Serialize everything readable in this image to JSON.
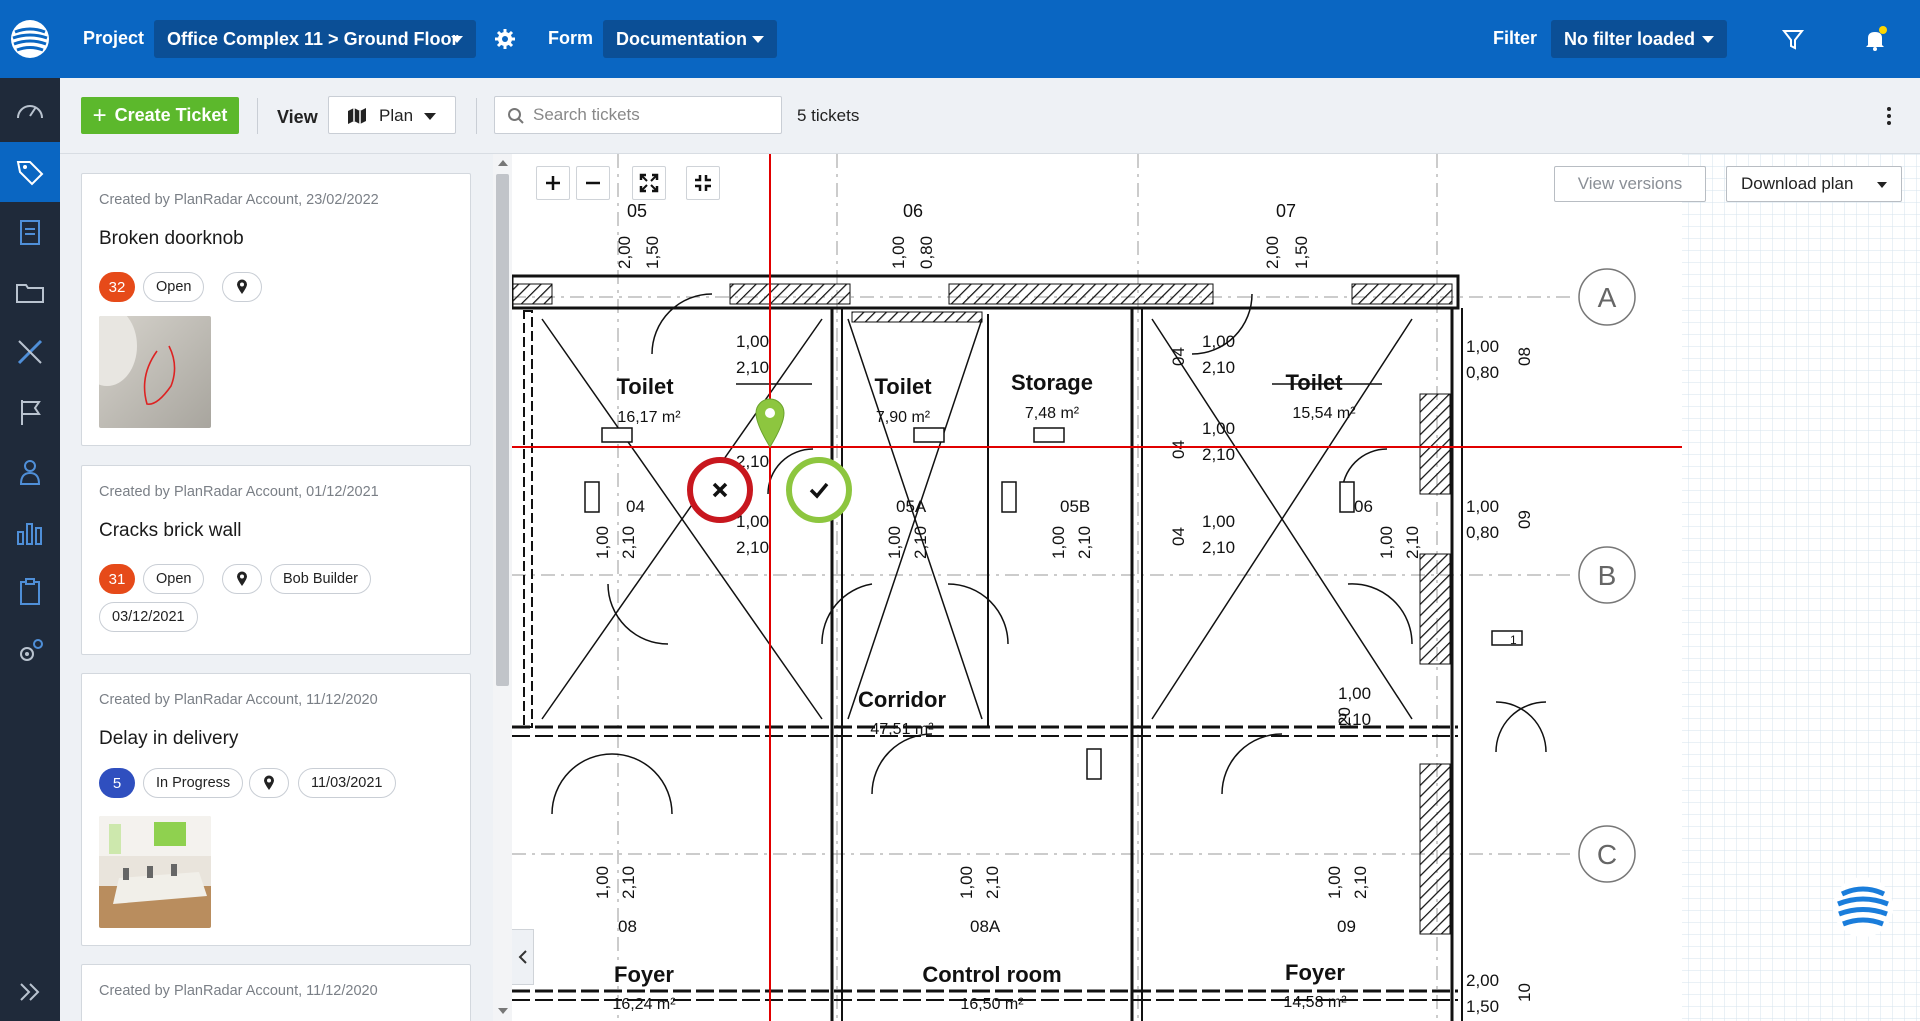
{
  "header": {
    "project_label": "Project",
    "project_value": "Office Complex 11 > Ground Floor",
    "form_label": "Form",
    "form_value": "Documentation",
    "filter_label": "Filter",
    "filter_value": "No filter loaded",
    "icons": [
      "settings-gear-icon",
      "funnel-icon",
      "bell-icon"
    ],
    "notification_dot_color": "#ffd600"
  },
  "sidebar": {
    "items": [
      {
        "name": "dashboard",
        "icon": "speedometer-icon"
      },
      {
        "name": "tickets",
        "icon": "tag-icon",
        "active": true
      },
      {
        "name": "reports",
        "icon": "clipboard-edit-icon"
      },
      {
        "name": "documents",
        "icon": "folder-icon"
      },
      {
        "name": "plans",
        "icon": "ruler-pencil-icon"
      },
      {
        "name": "milestones",
        "icon": "flag-icon"
      },
      {
        "name": "users",
        "icon": "person-icon"
      },
      {
        "name": "statistics",
        "icon": "bar-chart-icon"
      },
      {
        "name": "forms",
        "icon": "clipboard-icon"
      },
      {
        "name": "settings",
        "icon": "gears-icon"
      }
    ]
  },
  "toolbar": {
    "create_label": "Create Ticket",
    "view_label": "View",
    "view_value": "Plan",
    "search_placeholder": "Search tickets",
    "ticket_count": "5 tickets"
  },
  "tickets": [
    {
      "meta": "Created by PlanRadar Account, 23/02/2022",
      "title": "Broken doorknob",
      "number": "32",
      "number_color": "#e64a19",
      "status": "Open"
    },
    {
      "meta": "Created by PlanRadar Account, 01/12/2021",
      "title": "Cracks brick wall",
      "number": "31",
      "number_color": "#e64a19",
      "status": "Open",
      "assignee": "Bob Builder",
      "due_date": "03/12/2021"
    },
    {
      "meta": "Created by PlanRadar Account, 11/12/2020",
      "title": "Delay in delivery",
      "number": "5",
      "number_color": "#2f4fbf",
      "status": "In Progress",
      "due_date": "11/03/2021"
    },
    {
      "meta": "Created by PlanRadar Account, 11/12/2020"
    }
  ],
  "plan": {
    "view_versions_label": "View versions",
    "download_label": "Download plan",
    "grid_labels": [
      "A",
      "B",
      "C"
    ],
    "axis_labels": [
      "05",
      "06",
      "07"
    ],
    "rooms": [
      {
        "name": "Toilet",
        "area": "16,17 m²"
      },
      {
        "name": "Toilet",
        "area": "7,90 m²"
      },
      {
        "name": "Storage",
        "area": "7,48 m²"
      },
      {
        "name": "Toilet",
        "area": "15,54 m²"
      },
      {
        "name": "Corridor",
        "area": "47,51 m²"
      },
      {
        "name": "Foyer",
        "area": "16,24 m²"
      },
      {
        "name": "Control room",
        "area": "16,50 m²"
      },
      {
        "name": "Foyer",
        "area": "14,58 m²"
      }
    ],
    "door_codes": [
      "04",
      "05A",
      "05B",
      "06",
      "08",
      "08A",
      "09"
    ],
    "dims": {
      "top_05a": "2,00",
      "top_05b": "1,50",
      "top_06a": "1,00",
      "top_06b": "0,80",
      "top_07a": "2,00",
      "top_07b": "1,50",
      "d1": "1,00",
      "d2": "2,10",
      "side_08": "08",
      "side_09": "09",
      "side_10": "10",
      "side_04": "04",
      "side_20": "20",
      "r1a": "1,00",
      "r1b": "0,80",
      "r2a": "1,00",
      "r2b": "0,80",
      "r3a": "2,00",
      "r3b": "1,50",
      "stair": "1"
    }
  }
}
